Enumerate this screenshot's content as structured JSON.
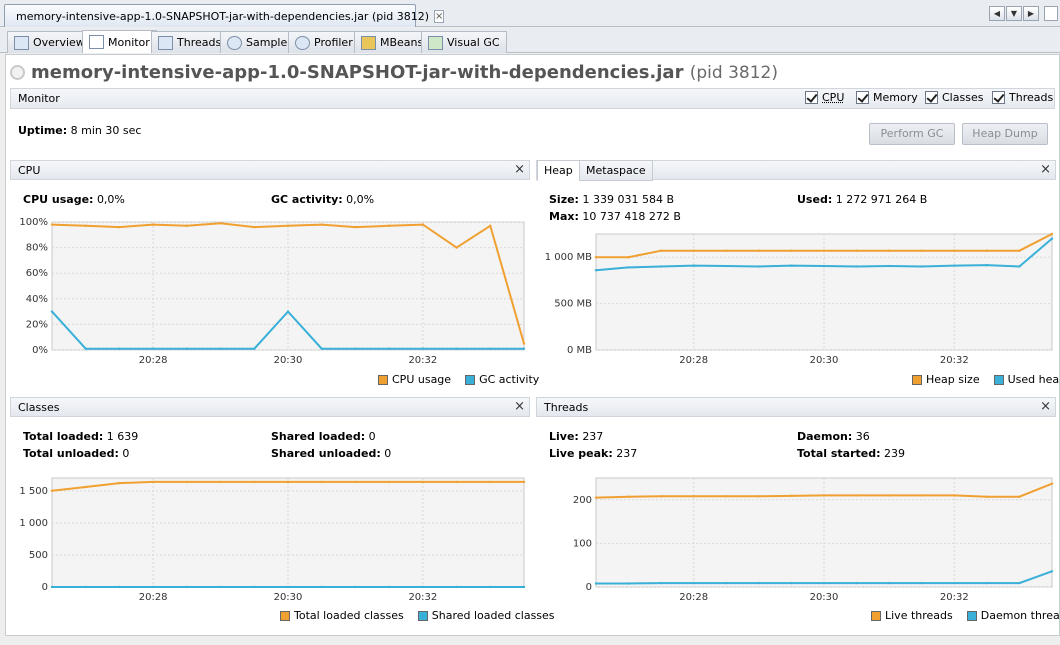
{
  "window": {
    "doc_tab_title": "memory-intensive-app-1.0-SNAPSHOT-jar-with-dependencies.jar (pid 3812)",
    "nav_left": "◀",
    "nav_down": "▼",
    "nav_right": "▶"
  },
  "subtabs": [
    {
      "label": "Overview",
      "icon": "overview-icon"
    },
    {
      "label": "Monitor",
      "icon": "monitor-icon"
    },
    {
      "label": "Threads",
      "icon": "threads-icon"
    },
    {
      "label": "Sampler",
      "icon": "sampler-icon"
    },
    {
      "label": "Profiler",
      "icon": "profiler-icon"
    },
    {
      "label": "MBeans",
      "icon": "mbeans-icon"
    },
    {
      "label": "Visual GC",
      "icon": "visualgc-icon"
    }
  ],
  "app": {
    "title": "memory-intensive-app-1.0-SNAPSHOT-jar-with-dependencies.jar",
    "pid": "(pid 3812)"
  },
  "monitor": {
    "title": "Monitor",
    "checkboxes": {
      "cpu": "CPU",
      "memory": "Memory",
      "classes": "Classes",
      "threads": "Threads"
    },
    "uptime_label": "Uptime:",
    "uptime_value": "8 min 30 sec",
    "perform_gc": "Perform GC",
    "heap_dump": "Heap Dump"
  },
  "cpu_panel": {
    "title": "CPU",
    "close": "×",
    "usage_label": "CPU usage:",
    "usage_value": "0,0%",
    "gc_label": "GC activity:",
    "gc_value": "0,0%",
    "yticks": [
      "100%",
      "80%",
      "60%",
      "40%",
      "20%",
      "0%"
    ],
    "xticks": [
      "20:28",
      "20:30",
      "20:32"
    ],
    "legend": {
      "cpu": "CPU usage",
      "gc": "GC activity"
    },
    "colors": {
      "cpu": "#f0a030",
      "gc": "#3ab0d8"
    }
  },
  "heap_panel": {
    "tab_heap": "Heap",
    "tab_metaspace": "Metaspace",
    "close": "×",
    "size_label": "Size:",
    "size_value": "1 339 031 584 B",
    "used_label": "Used:",
    "used_value": "1 272 971 264 B",
    "max_label": "Max:",
    "max_value": "10 737 418 272 B",
    "yticks": [
      "1 000 MB",
      "500 MB",
      "0 MB"
    ],
    "xticks": [
      "20:28",
      "20:30",
      "20:32"
    ],
    "legend": {
      "size": "Heap size",
      "used": "Used heap"
    }
  },
  "classes_panel": {
    "title": "Classes",
    "close": "×",
    "total_loaded_label": "Total loaded:",
    "total_loaded_value": "1 639",
    "total_unloaded_label": "Total unloaded:",
    "total_unloaded_value": "0",
    "shared_loaded_label": "Shared loaded:",
    "shared_loaded_value": "0",
    "shared_unloaded_label": "Shared unloaded:",
    "shared_unloaded_value": "0",
    "yticks": [
      "1 500",
      "1 000",
      "500",
      "0"
    ],
    "xticks": [
      "20:28",
      "20:30",
      "20:32"
    ],
    "legend": {
      "total": "Total loaded classes",
      "shared": "Shared loaded classes"
    }
  },
  "threads_panel": {
    "title": "Threads",
    "close": "×",
    "live_label": "Live:",
    "live_value": "237",
    "daemon_label": "Daemon:",
    "daemon_value": "36",
    "peak_label": "Live peak:",
    "peak_value": "237",
    "started_label": "Total started:",
    "started_value": "239",
    "yticks": [
      "200",
      "100",
      "0"
    ],
    "xticks": [
      "20:28",
      "20:30",
      "20:32"
    ],
    "legend": {
      "live": "Live threads",
      "daemon": "Daemon threads"
    }
  },
  "chart_data": [
    {
      "type": "line",
      "title": "CPU",
      "ylim": [
        0,
        100
      ],
      "x": [
        "20:26:30",
        "20:27",
        "20:27:30",
        "20:28",
        "20:28:30",
        "20:29",
        "20:29:30",
        "20:30",
        "20:30:30",
        "20:31",
        "20:31:30",
        "20:32",
        "20:32:30",
        "20:33",
        "20:33:30"
      ],
      "series": [
        {
          "name": "CPU usage",
          "values": [
            98,
            97,
            96,
            98,
            97,
            99,
            96,
            97,
            98,
            96,
            97,
            98,
            80,
            97,
            5
          ]
        },
        {
          "name": "GC activity",
          "values": [
            30,
            1,
            1,
            1,
            1,
            1,
            1,
            30,
            1,
            1,
            1,
            1,
            1,
            1,
            1
          ]
        }
      ]
    },
    {
      "type": "area",
      "title": "Heap",
      "ylim": [
        0,
        1250
      ],
      "x": [
        "20:26:30",
        "20:27",
        "20:27:30",
        "20:28",
        "20:28:30",
        "20:29",
        "20:29:30",
        "20:30",
        "20:30:30",
        "20:31",
        "20:31:30",
        "20:32",
        "20:32:30",
        "20:33",
        "20:33:30"
      ],
      "series": [
        {
          "name": "Heap size",
          "values": [
            1000,
            1000,
            1070,
            1070,
            1070,
            1070,
            1070,
            1070,
            1070,
            1070,
            1070,
            1070,
            1070,
            1070,
            1250
          ]
        },
        {
          "name": "Used heap",
          "values": [
            860,
            890,
            900,
            910,
            905,
            900,
            910,
            905,
            900,
            905,
            900,
            910,
            915,
            900,
            1200
          ]
        }
      ]
    },
    {
      "type": "line",
      "title": "Classes",
      "ylim": [
        0,
        1700
      ],
      "x": [
        "20:26:30",
        "20:27",
        "20:27:30",
        "20:28",
        "20:28:30",
        "20:29",
        "20:29:30",
        "20:30",
        "20:30:30",
        "20:31",
        "20:31:30",
        "20:32",
        "20:32:30",
        "20:33",
        "20:33:30"
      ],
      "series": [
        {
          "name": "Total loaded classes",
          "values": [
            1500,
            1560,
            1620,
            1639,
            1639,
            1639,
            1639,
            1639,
            1639,
            1639,
            1639,
            1639,
            1639,
            1639,
            1639
          ]
        },
        {
          "name": "Shared loaded classes",
          "values": [
            0,
            0,
            0,
            0,
            0,
            0,
            0,
            0,
            0,
            0,
            0,
            0,
            0,
            0,
            0
          ]
        }
      ]
    },
    {
      "type": "line",
      "title": "Threads",
      "ylim": [
        0,
        250
      ],
      "x": [
        "20:26:30",
        "20:27",
        "20:27:30",
        "20:28",
        "20:28:30",
        "20:29",
        "20:29:30",
        "20:30",
        "20:30:30",
        "20:31",
        "20:31:30",
        "20:32",
        "20:32:30",
        "20:33",
        "20:33:30"
      ],
      "series": [
        {
          "name": "Live threads",
          "values": [
            205,
            207,
            208,
            208,
            208,
            208,
            209,
            210,
            210,
            210,
            210,
            210,
            207,
            207,
            237
          ]
        },
        {
          "name": "Daemon threads",
          "values": [
            8,
            8,
            9,
            9,
            9,
            9,
            9,
            9,
            9,
            9,
            9,
            9,
            9,
            9,
            36
          ]
        }
      ]
    }
  ]
}
